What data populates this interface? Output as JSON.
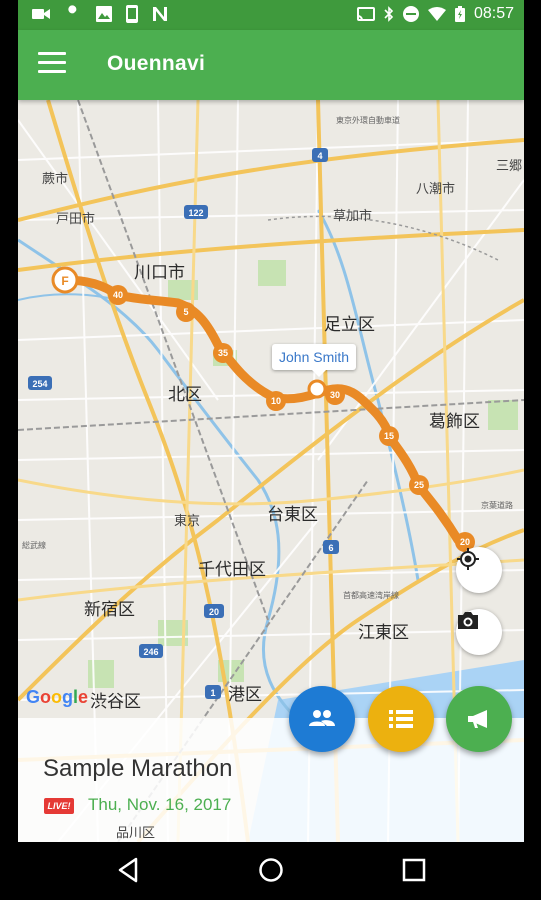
{
  "status_bar": {
    "time": "08:57",
    "left_icons": [
      "video-camera-icon",
      "wrench-icon",
      "image-icon",
      "phone-icon",
      "n-icon"
    ],
    "right_icons": [
      "cast-icon",
      "bluetooth-icon",
      "do-not-disturb-icon",
      "wifi-icon",
      "battery-icon"
    ]
  },
  "app_bar": {
    "title": "Ouennavi",
    "color": "#4caf50",
    "status_color": "#3f9a3d"
  },
  "map": {
    "places": {
      "warabi": "蕨市",
      "toda": "戸田市",
      "kawaguchi": "川口市",
      "soka": "草加市",
      "yashio": "八潮市",
      "misato": "三郷",
      "adachi": "足立区",
      "kita": "北区",
      "katsushika": "葛飾区",
      "taito": "台東区",
      "tokyo": "東京",
      "chiyoda": "千代田区",
      "shinjuku": "新宿区",
      "koto": "江東区",
      "minato": "港区",
      "shibuya": "渋谷区",
      "shinagawa": "品川区",
      "tokyo_outer_ring": "東京外環自動車道",
      "shutoko_wangan": "首都高速湾岸線",
      "keiyo": "京葉道路",
      "sosubu": "総武線"
    },
    "road_shields": [
      "122",
      "4",
      "254",
      "6",
      "20",
      "246",
      "1"
    ],
    "route": {
      "color": "#e98a26",
      "start_label": "F",
      "km_markers": [
        "40",
        "5",
        "35",
        "10",
        "30",
        "15",
        "25",
        "20"
      ]
    },
    "runner": {
      "name": "John Smith"
    },
    "google_logo": [
      "G",
      "o",
      "o",
      "g",
      "l",
      "e"
    ]
  },
  "map_controls": {
    "locate_icon": "my-location-icon",
    "camera_icon": "camera-icon"
  },
  "fabs": [
    {
      "icon": "group-icon",
      "color": "#1e7bd4"
    },
    {
      "icon": "list-icon",
      "color": "#ecb10f"
    },
    {
      "icon": "megaphone-icon",
      "color": "#4caf50"
    }
  ],
  "event": {
    "title": "Sample Marathon",
    "live_label": "LIVE!",
    "date": "Thu, Nov. 16, 2017"
  },
  "nav_bar": {
    "icons": [
      "back-icon",
      "home-icon",
      "recents-icon"
    ]
  }
}
